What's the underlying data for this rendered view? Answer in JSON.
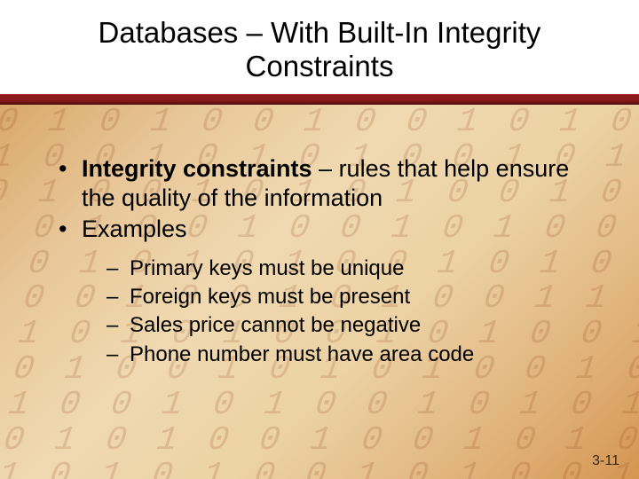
{
  "title": "Databases – With Built-In Integrity Constraints",
  "bullets": [
    {
      "bold": "Integrity constraints",
      "rest": " – rules that help ensure the quality of the information"
    },
    {
      "bold": "",
      "rest": "Examples"
    }
  ],
  "sub_bullets": [
    "Primary keys must be unique",
    "Foreign keys must be present",
    "Sales price cannot be negative",
    "Phone number must have area code"
  ],
  "page_number": "3-11",
  "bg_binary": "0 1 0 1 0 0 1 0 0 1 0 1 0 0 1 0\n1 0 0 1 0 1 0 1 0 0 1 0 1 0 0 1\n0 1 0 0 1 0 1 0 1 0 0 1 0 1 0 0\n1 0 1 0 0 1 0 0 1 0 1 0 0 1 0 1\n0 0 1 0 1 0 1 0 0 1 0 1 0 0 1 0\n1 0 0 1 0 0 1 0 1 0 0 1 1 0 0 1\n0 1 0 1 0 1 0 0 1 0 1 0 0 1 0 0\n1 0 1 0 0 1 0 1 0 1 0 0 1 0 1 0\n0 1 0 0 1 0 1 0 0 1 0 1 0 1 0 1\n1 0 1 0 1 0 0 1 0 0 1 0 1 0 0 1\n0 1 0 1 0 1 0 0 1 0 1 0 0 1 0 0"
}
